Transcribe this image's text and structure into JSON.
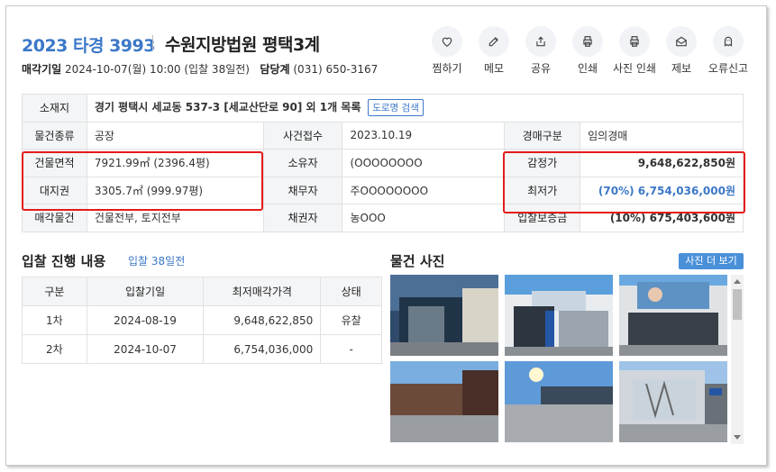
{
  "header": {
    "case_number": "2023 타경 3993",
    "court": "수원지방법원 평택3계",
    "sale_date_label": "매각기일",
    "sale_date_value": "2024-10-07(월) 10:00 (입찰 38일전)",
    "manager_label": "담당계",
    "manager_phone": "(031) 650-3167"
  },
  "actions": [
    {
      "label": "찜하기",
      "icon": "heart-icon"
    },
    {
      "label": "메모",
      "icon": "pencil-icon"
    },
    {
      "label": "공유",
      "icon": "share-icon"
    },
    {
      "label": "인쇄",
      "icon": "printer-icon"
    },
    {
      "label": "사진 인쇄",
      "icon": "printer-icon"
    },
    {
      "label": "제보",
      "icon": "envelope-icon"
    },
    {
      "label": "오류신고",
      "icon": "ghost-icon"
    }
  ],
  "info": {
    "location_label": "소재지",
    "location_value": "경기 평택시 세교동 537-3 [세교산단로 90] 외 1개 목록",
    "road_search_btn": "도로명 검색",
    "type_label": "물건종류",
    "type_value": "공장",
    "case_received_label": "사건접수",
    "case_received_value": "2023.10.19",
    "auction_type_label": "경매구분",
    "auction_type_value": "임의경매",
    "building_area_label": "건물면적",
    "building_area_value": "7921.99㎡ (2396.4평)",
    "owner_label": "소유자",
    "owner_value": "(OOOOOOOO",
    "appraisal_label": "감정가",
    "appraisal_value": "9,648,622,850원",
    "land_right_label": "대지권",
    "land_right_value": "3305.7㎡ (999.97평)",
    "debtor_label": "채무자",
    "debtor_value": "주OOOOOOOO",
    "min_price_label": "최저가",
    "min_price_value": "(70%) 6,754,036,000원",
    "sale_item_label": "매각물건",
    "sale_item_value": "건물전부, 토지전부",
    "creditor_label": "채권자",
    "creditor_value": "농OOO",
    "deposit_label": "입찰보증금",
    "deposit_value": "(10%) 675,403,600원"
  },
  "bids": {
    "title": "입찰 진행 내용",
    "subtitle": "입찰 38일전",
    "headers": [
      "구분",
      "입찰기일",
      "최저매각가격",
      "상태"
    ],
    "rows": [
      [
        "1차",
        "2024-08-19",
        "9,648,622,850",
        "유찰"
      ],
      [
        "2차",
        "2024-10-07",
        "6,754,036,000",
        "-"
      ]
    ]
  },
  "photos": {
    "title": "물건 사진",
    "more_btn": "사진 더 보기"
  },
  "colors": {
    "accent": "#3c78c8",
    "highlight_box": "#e41b1b",
    "header_cell_bg": "#f4f5f7"
  }
}
